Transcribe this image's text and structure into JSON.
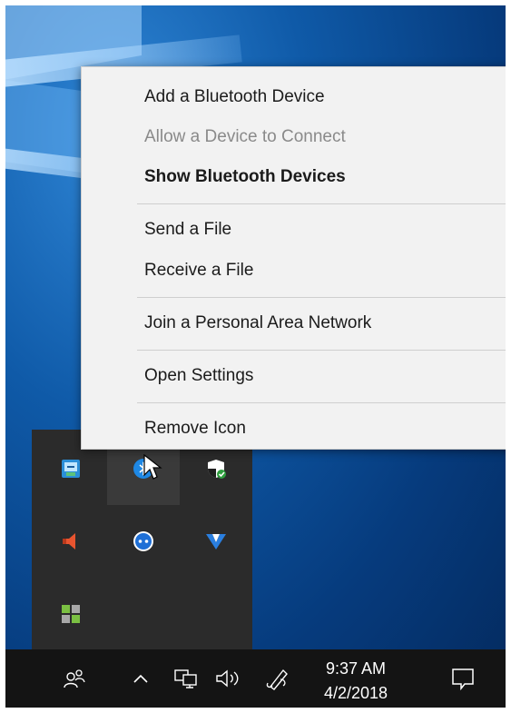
{
  "context_menu": {
    "items": [
      {
        "label": "Add a Bluetooth Device",
        "state": "normal"
      },
      {
        "label": "Allow a Device to Connect",
        "state": "disabled"
      },
      {
        "label": "Show Bluetooth Devices",
        "state": "bold"
      },
      {
        "label": "Send a File",
        "state": "normal"
      },
      {
        "label": "Receive a File",
        "state": "normal"
      },
      {
        "label": "Join a Personal Area Network",
        "state": "normal"
      },
      {
        "label": "Open Settings",
        "state": "normal"
      },
      {
        "label": "Remove Icon",
        "state": "normal"
      }
    ]
  },
  "tray_overflow": {
    "icons": [
      "network-adapter-icon",
      "bluetooth-icon",
      "windows-defender-icon",
      "speaker-orange-icon",
      "teamviewer-icon",
      "vpn-v-icon",
      "green-grid-app-icon"
    ]
  },
  "taskbar": {
    "icons": [
      "people-icon",
      "chevron-up-icon",
      "network-icon",
      "volume-icon",
      "pen-ink-icon",
      "action-center-icon"
    ],
    "time": "9:37 AM",
    "date": "4/2/2018"
  },
  "colors": {
    "menu_bg": "#f2f2f2",
    "tray_bg": "#2b2b2b",
    "taskbar_bg": "#141414",
    "bluetooth_blue": "#1e88e5",
    "defender_green": "#2e9e3e"
  }
}
